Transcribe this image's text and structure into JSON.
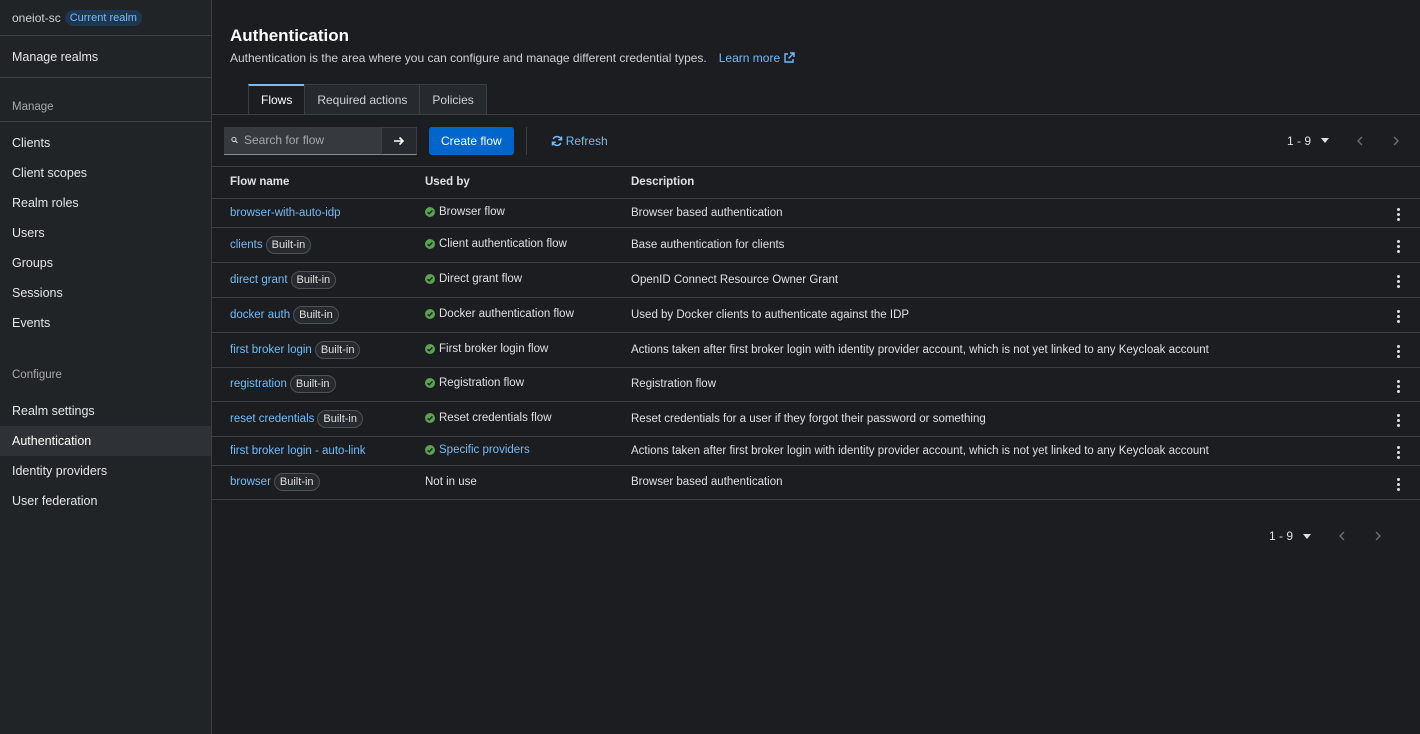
{
  "sidebar": {
    "realm_name": "oneiot-sc",
    "realm_badge": "Current realm",
    "manage_realms": "Manage realms",
    "manage_title": "Manage",
    "manage_items": [
      "Clients",
      "Client scopes",
      "Realm roles",
      "Users",
      "Groups",
      "Sessions",
      "Events"
    ],
    "configure_title": "Configure",
    "configure_items": [
      "Realm settings",
      "Authentication",
      "Identity providers",
      "User federation"
    ],
    "active_item": "Authentication"
  },
  "header": {
    "title": "Authentication",
    "description": "Authentication is the area where you can configure and manage different credential types.",
    "learn_more": "Learn more"
  },
  "tabs": [
    {
      "label": "Flows",
      "active": true
    },
    {
      "label": "Required actions",
      "active": false
    },
    {
      "label": "Policies",
      "active": false
    }
  ],
  "toolbar": {
    "search_placeholder": "Search for flow",
    "create_label": "Create flow",
    "refresh_label": "Refresh"
  },
  "pagination": {
    "range": "1 - 9"
  },
  "table": {
    "headers": {
      "name": "Flow name",
      "used_by": "Used by",
      "description": "Description"
    },
    "rows": [
      {
        "name": "browser-with-auto-idp",
        "builtin": "",
        "used_by": "Browser flow",
        "used_status": "check",
        "description": "Browser based authentication"
      },
      {
        "name": "clients",
        "builtin": "Built-in",
        "used_by": "Client authentication flow",
        "used_status": "check",
        "description": "Base authentication for clients"
      },
      {
        "name": "direct grant",
        "builtin": "Built-in",
        "used_by": "Direct grant flow",
        "used_status": "check",
        "description": "OpenID Connect Resource Owner Grant"
      },
      {
        "name": "docker auth",
        "builtin": "Built-in",
        "used_by": "Docker authentication flow",
        "used_status": "check",
        "description": "Used by Docker clients to authenticate against the IDP"
      },
      {
        "name": "first broker login",
        "builtin": "Built-in",
        "used_by": "First broker login flow",
        "used_status": "check",
        "description": "Actions taken after first broker login with identity provider account, which is not yet linked to any Keycloak account"
      },
      {
        "name": "registration",
        "builtin": "Built-in",
        "used_by": "Registration flow",
        "used_status": "check",
        "description": "Registration flow"
      },
      {
        "name": "reset credentials",
        "builtin": "Built-in",
        "used_by": "Reset credentials flow",
        "used_status": "check",
        "description": "Reset credentials for a user if they forgot their password or something"
      },
      {
        "name": "first broker login - auto-link",
        "builtin": "",
        "used_by": "Specific providers",
        "used_status": "link",
        "description": "Actions taken after first broker login with identity provider account, which is not yet linked to any Keycloak account"
      },
      {
        "name": "browser",
        "builtin": "Built-in",
        "used_by": "Not in use",
        "used_status": "none",
        "description": "Browser based authentication"
      }
    ]
  },
  "colors": {
    "accent": "#73bcf7",
    "primary_button": "#0066cc",
    "success": "#3e8635",
    "background": "#1b1d21",
    "sidebar": "#212427"
  },
  "icons": {
    "search": "search-icon",
    "arrow": "arrow-right-icon",
    "refresh": "sync-icon",
    "external": "external-link-icon",
    "check": "check-circle-icon",
    "kebab": "kebab-icon",
    "caret": "caret-down-icon"
  }
}
